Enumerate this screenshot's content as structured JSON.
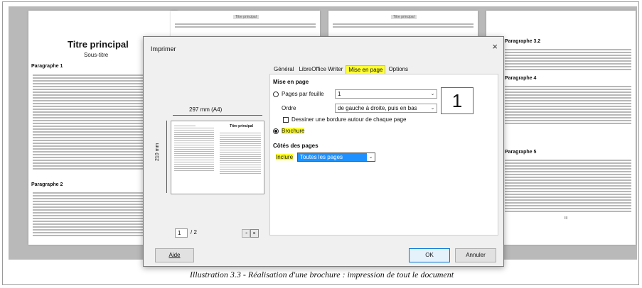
{
  "background_doc": {
    "page1_title": "Titre principal",
    "page1_subtitle": "Sous-titre",
    "page1_heading1": "Paragraphe 1",
    "page1_heading2": "Paragraphe 2",
    "page2_tag": "Titre principal",
    "page3_tag": "Titre principal",
    "page4_heading1": "Paragraphe 3.2",
    "page4_heading2": "Paragraphe 4",
    "page4_heading3": "Paragraphe 5",
    "page_number": "III"
  },
  "dialog": {
    "title": "Imprimer",
    "close_label": "×",
    "tabs": [
      "Général",
      "LibreOffice Writer",
      "Mise en page",
      "Options"
    ],
    "active_tab": "Mise en page",
    "section_layout": "Mise en page",
    "pages_per_sheet_label": "Pages par feuille",
    "pages_per_sheet_value": "1",
    "big_number": "1",
    "order_label": "Ordre",
    "order_value": "de gauche à droite, puis en bas",
    "border_checkbox_label": "Dessiner une bordure autour de chaque page",
    "brochure_label": "Brochure",
    "section_sides": "Côtés des pages",
    "include_label": "Inclure",
    "include_value": "Toutes les pages",
    "preview_width": "297 mm (A4)",
    "preview_height": "210 mm",
    "preview_thumb_title": "Titre principal",
    "page_index": "1",
    "page_total": "/ 2",
    "help_button": "Aide",
    "ok_button": "OK",
    "cancel_button": "Annuler"
  },
  "caption": "Illustration 3.3 - Réalisation d'une brochure : impression de tout le document",
  "colors": {
    "highlight": "#ffff33",
    "selection": "#1e90ff"
  }
}
